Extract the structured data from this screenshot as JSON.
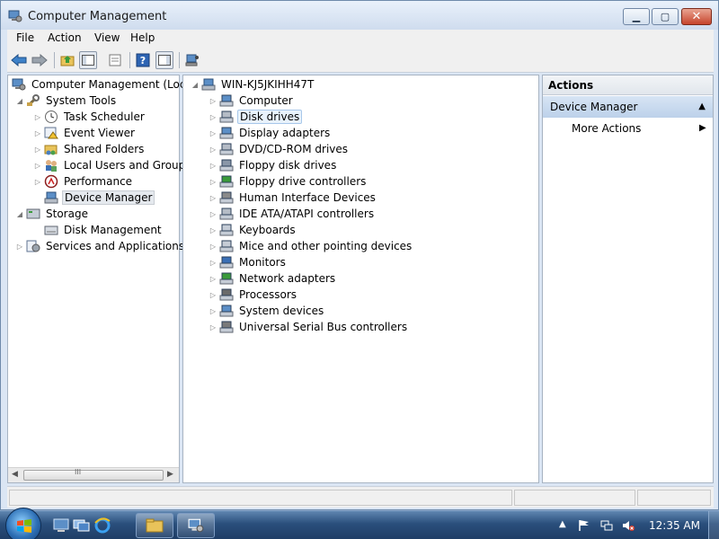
{
  "window": {
    "title": "Computer Management"
  },
  "menu": [
    "File",
    "Action",
    "View",
    "Help"
  ],
  "left_tree": {
    "root": "Computer Management (Local",
    "system_tools": "System Tools",
    "system_tools_children": [
      "Task Scheduler",
      "Event Viewer",
      "Shared Folders",
      "Local Users and Groups",
      "Performance",
      "Device Manager"
    ],
    "storage": "Storage",
    "storage_children": [
      "Disk Management"
    ],
    "services": "Services and Applications",
    "scroll_grip": "III"
  },
  "device_tree": {
    "root": "WIN-KJ5JKIHH47T",
    "categories": [
      "Computer",
      "Disk drives",
      "Display adapters",
      "DVD/CD-ROM drives",
      "Floppy disk drives",
      "Floppy drive controllers",
      "Human Interface Devices",
      "IDE ATA/ATAPI controllers",
      "Keyboards",
      "Mice and other pointing devices",
      "Monitors",
      "Network adapters",
      "Processors",
      "System devices",
      "Universal Serial Bus controllers"
    ]
  },
  "actions": {
    "header": "Actions",
    "section": "Device Manager",
    "item": "More Actions"
  },
  "taskbar": {
    "clock": "12:35 AM"
  },
  "colors": {
    "accent": "#3c7fb1",
    "selection": "#e5e9ee",
    "actions_section": "#c9daf0"
  }
}
